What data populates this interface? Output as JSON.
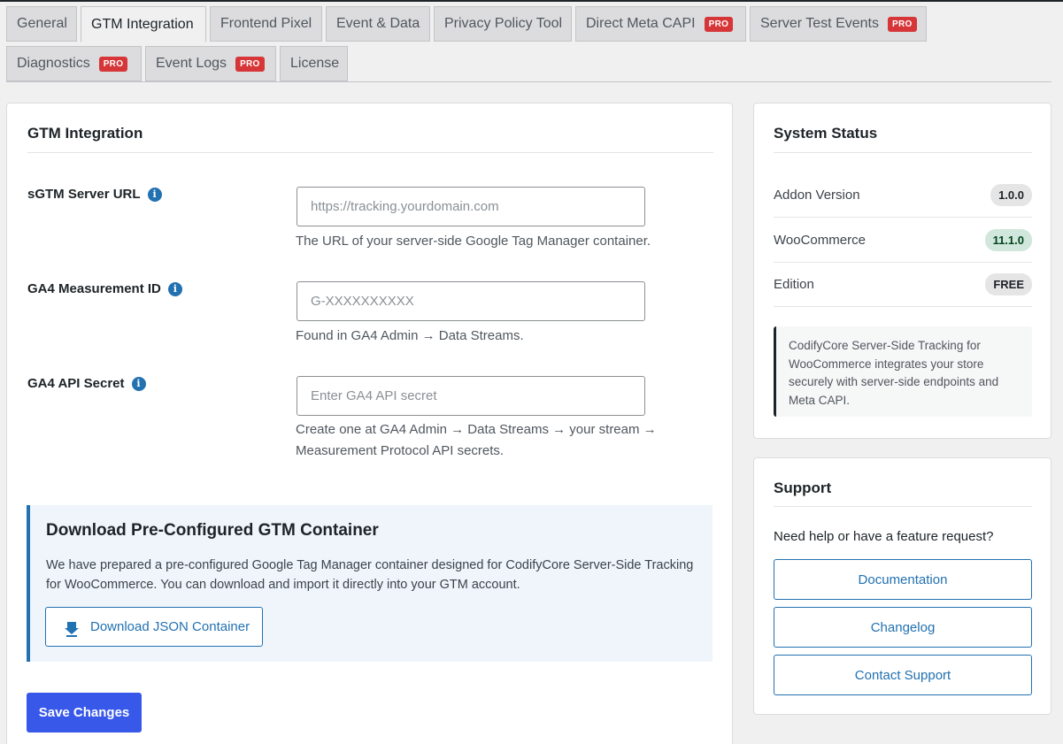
{
  "tabs": [
    {
      "label": "General",
      "pro": ""
    },
    {
      "label": "GTM Integration",
      "pro": ""
    },
    {
      "label": "Frontend Pixel",
      "pro": ""
    },
    {
      "label": "Event & Data",
      "pro": ""
    },
    {
      "label": "Privacy Policy Tool",
      "pro": ""
    },
    {
      "label": "Direct Meta CAPI",
      "pro": "PRO"
    },
    {
      "label": "Server Test Events",
      "pro": "PRO"
    },
    {
      "label": "Diagnostics",
      "pro": "PRO"
    },
    {
      "label": "Event Logs",
      "pro": "PRO"
    },
    {
      "label": "License",
      "pro": ""
    }
  ],
  "active_tab": "GTM Integration",
  "main": {
    "title": "GTM Integration",
    "fields": [
      {
        "label": "sGTM Server URL",
        "value": "",
        "placeholder": "https://tracking.yourdomain.com",
        "help": "The URL of your server-side Google Tag Manager container."
      },
      {
        "label": "GA4 Measurement ID",
        "value": "",
        "placeholder": "G-XXXXXXXXXX",
        "help": "Found in GA4 Admin → Data Streams."
      },
      {
        "label": "GA4 API Secret",
        "value": "",
        "placeholder": "Enter GA4 API secret",
        "help_line1": "Create one at GA4 Admin → Data Streams → your stream →",
        "help_line2": "Measurement Protocol API secrets."
      }
    ],
    "download": {
      "title": "Download Pre-Configured GTM Container",
      "text": "We have prepared a pre-configured Google Tag Manager container designed for CodifyCore Server-Side Tracking for WooCommerce. You can download and import it directly into your GTM account.",
      "button": "Download JSON Container"
    },
    "save_button": "Save Changes"
  },
  "sidebar": {
    "status": {
      "title": "System Status",
      "rows": [
        {
          "label": "Addon Version",
          "value": "1.0.0"
        },
        {
          "label": "WooCommerce",
          "value": "11.1.0"
        },
        {
          "label": "Edition",
          "value": "FREE"
        }
      ],
      "note": "CodifyCore Server-Side Tracking for WooCommerce integrates your store securely with server-side endpoints and Meta CAPI."
    },
    "support": {
      "title": "Support",
      "text": "Need help or have a feature request?",
      "buttons": [
        "Documentation",
        "Changelog",
        "Contact Support"
      ]
    }
  },
  "colors": {
    "accent": "#2271b1",
    "primary_button": "#3858e9",
    "pro_badge": "#d63638",
    "success_badge": "#d1e7dd"
  },
  "icons": {
    "info": "info-icon",
    "download": "download-icon"
  }
}
